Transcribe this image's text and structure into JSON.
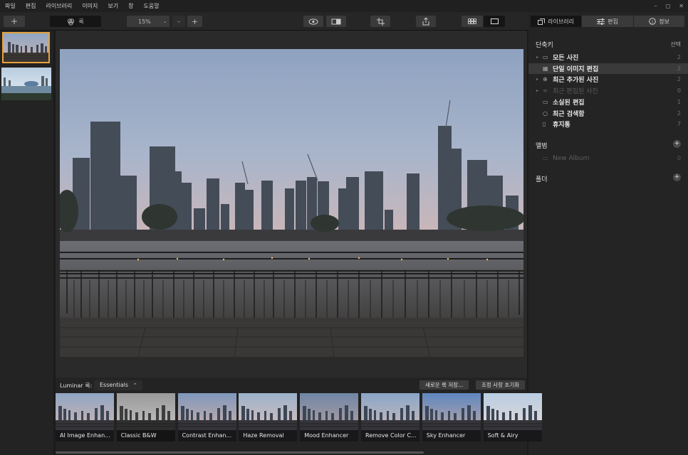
{
  "menu": [
    "파일",
    "편집",
    "라이브러리",
    "이미지",
    "보기",
    "창",
    "도움말"
  ],
  "window_controls": [
    "–",
    "◻",
    "✕"
  ],
  "toolbar": {
    "add_label": "+",
    "looks_label": "룩",
    "zoom_value": "15%",
    "zoom_minus": "–",
    "zoom_plus": "+"
  },
  "right_tabs": [
    {
      "label": "라이브러리",
      "icon": "library-icon"
    },
    {
      "label": "편집",
      "icon": "sliders-icon"
    },
    {
      "label": "정보",
      "icon": "info-icon"
    }
  ],
  "shortcuts": {
    "title": "단축키",
    "select_label": "선택",
    "items": [
      {
        "label": "모든 사진",
        "count": "2",
        "icon": "photos-icon",
        "arrow": true,
        "dim": false,
        "selected": false
      },
      {
        "label": "단일 이미지 편집",
        "count": "2",
        "icon": "grid-icon",
        "arrow": false,
        "dim": false,
        "selected": true
      },
      {
        "label": "최근 추가된 사진",
        "count": "2",
        "icon": "add-circle-icon",
        "arrow": true,
        "dim": false,
        "selected": false
      },
      {
        "label": "최근 편집된 사진",
        "count": "0",
        "icon": "sliders-icon",
        "arrow": true,
        "dim": true,
        "selected": false
      },
      {
        "label": "소실된 편집",
        "count": "1",
        "icon": "missing-icon",
        "arrow": false,
        "dim": false,
        "selected": false
      },
      {
        "label": "최근 검색함",
        "count": "2",
        "icon": "search-icon",
        "arrow": false,
        "dim": false,
        "selected": false
      },
      {
        "label": "휴지통",
        "count": "7",
        "icon": "trash-icon",
        "arrow": false,
        "dim": false,
        "selected": false
      }
    ]
  },
  "albums": {
    "title": "앨범",
    "new_album": "New Album",
    "new_album_count": "0"
  },
  "folders": {
    "title": "폴더"
  },
  "looks": {
    "label": "Luminar 룩:",
    "collection": "Essentials",
    "save_button": "새로운 룩 저장...",
    "reset_button": "조정 사항 초기화",
    "items": [
      "AI Image Enhan...",
      "Classic B&W",
      "Contrast Enhan...",
      "Haze Removal",
      "Mood Enhancer",
      "Remove Color C...",
      "Sky Enhancer",
      "Soft & Airy"
    ]
  }
}
